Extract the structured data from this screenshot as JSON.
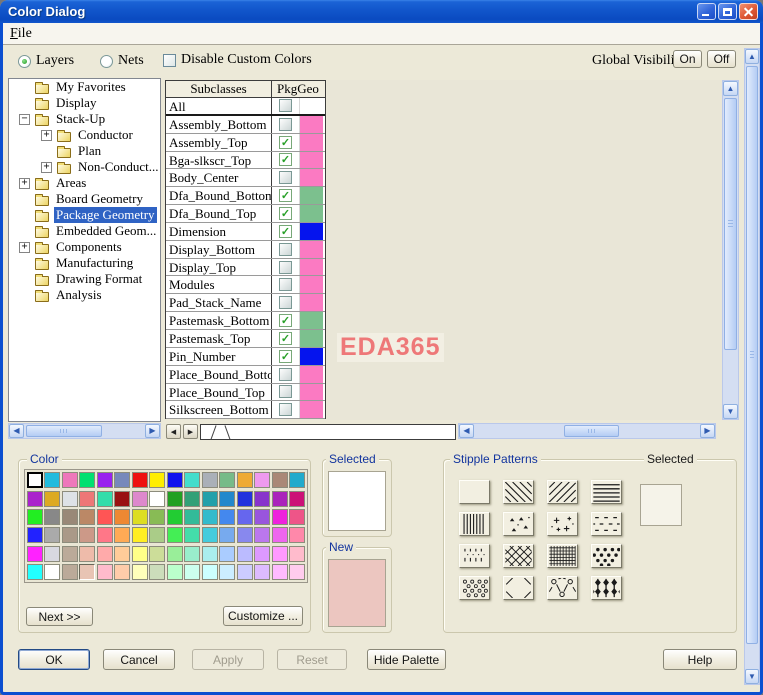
{
  "window": {
    "title": "Color Dialog"
  },
  "menu": {
    "items": [
      {
        "label": "File"
      }
    ]
  },
  "toolbar": {
    "layers_label": "Layers",
    "nets_label": "Nets",
    "disable_custom_label": "Disable Custom Colors",
    "global_visibility_label": "Global Visibility:",
    "on_label": "On",
    "off_label": "Off"
  },
  "tree": {
    "items": [
      {
        "label": "My Favorites",
        "level": 1,
        "expander": "none",
        "selected": false
      },
      {
        "label": "Display",
        "level": 1,
        "expander": "none",
        "selected": false
      },
      {
        "label": "Stack-Up",
        "level": 1,
        "expander": "minus",
        "selected": false
      },
      {
        "label": "Conductor",
        "level": 2,
        "expander": "plus",
        "selected": false
      },
      {
        "label": "Plan",
        "level": 2,
        "expander": "none",
        "selected": false
      },
      {
        "label": "Non-Conduct...",
        "level": 2,
        "expander": "plus",
        "selected": false
      },
      {
        "label": "Areas",
        "level": 1,
        "expander": "plus",
        "selected": false
      },
      {
        "label": "Board Geometry",
        "level": 1,
        "expander": "none",
        "selected": false
      },
      {
        "label": "Package Geometry",
        "level": 1,
        "expander": "none",
        "selected": true
      },
      {
        "label": "Embedded Geom...",
        "level": 1,
        "expander": "none",
        "selected": false
      },
      {
        "label": "Components",
        "level": 1,
        "expander": "plus",
        "selected": false
      },
      {
        "label": "Manufacturing",
        "level": 1,
        "expander": "none",
        "selected": false
      },
      {
        "label": "Drawing Format",
        "level": 1,
        "expander": "none",
        "selected": false
      },
      {
        "label": "Analysis",
        "level": 1,
        "expander": "none",
        "selected": false
      }
    ]
  },
  "table": {
    "columns": [
      "Subclasses",
      "PkgGeo"
    ],
    "rows": [
      {
        "name": "All",
        "checked": false,
        "color": null
      },
      {
        "name": "Assembly_Bottom",
        "checked": false,
        "color": "#fb7ac2"
      },
      {
        "name": "Assembly_Top",
        "checked": true,
        "color": "#fb7ac2"
      },
      {
        "name": "Bga-slkscr_Top",
        "checked": true,
        "color": "#fb7ac2"
      },
      {
        "name": "Body_Center",
        "checked": false,
        "color": "#fb7ac2"
      },
      {
        "name": "Dfa_Bound_Bottom",
        "checked": true,
        "color": "#7cc08e"
      },
      {
        "name": "Dfa_Bound_Top",
        "checked": true,
        "color": "#7cc08e"
      },
      {
        "name": "Dimension",
        "checked": true,
        "color": "#0514ee"
      },
      {
        "name": "Display_Bottom",
        "checked": false,
        "color": "#fb7ac2"
      },
      {
        "name": "Display_Top",
        "checked": false,
        "color": "#fb7ac2"
      },
      {
        "name": "Modules",
        "checked": false,
        "color": "#fb7ac2"
      },
      {
        "name": "Pad_Stack_Name",
        "checked": false,
        "color": "#fb7ac2"
      },
      {
        "name": "Pastemask_Bottom",
        "checked": true,
        "color": "#7cc08e"
      },
      {
        "name": "Pastemask_Top",
        "checked": true,
        "color": "#7cc08e"
      },
      {
        "name": "Pin_Number",
        "checked": true,
        "color": "#0514ee"
      },
      {
        "name": "Place_Bound_Bottom",
        "checked": false,
        "color": "#fb7ac2"
      },
      {
        "name": "Place_Bound_Top",
        "checked": false,
        "color": "#fb7ac2"
      },
      {
        "name": "Silkscreen_Bottom",
        "checked": false,
        "color": "#fb7ac2"
      }
    ]
  },
  "canvas": {
    "watermark": "EDA365",
    "watermark_color": "#ee7878"
  },
  "palette": {
    "title": "Color",
    "next_label": "Next >>",
    "customize_label": "Customize ...",
    "selected": {
      "row": 0,
      "col": 0
    },
    "pressed": {
      "row": 5,
      "col": 3
    },
    "rows": [
      [
        "#ffffff",
        "#22bbdd",
        "#ee77bb",
        "#00e070",
        "#9922ee",
        "#7788bb",
        "#ee1111",
        "#ffee00",
        "#1111ee",
        "#44ddcc",
        "#aab0b8",
        "#77bb88",
        "#eeaa33",
        "#ee99ee",
        "#aa8877",
        "#22aacc"
      ],
      [
        "#aa22cc",
        "#ddaa22",
        "#dde2e6",
        "#ee7777",
        "#33ddaa",
        "#991111",
        "#dd88cc",
        "#ffffff",
        "#22a022",
        "#33a077",
        "#22a0aa",
        "#2288cc",
        "#2233dd",
        "#8833cc",
        "#aa22bb",
        "#cc1177"
      ],
      [
        "#22ee22",
        "#888888",
        "#998877",
        "#bb8866",
        "#ff5555",
        "#ee8833",
        "#dddd22",
        "#88bb55",
        "#22cc33",
        "#33bb99",
        "#33bbcc",
        "#4488ee",
        "#6666ee",
        "#9955dd",
        "#ee22dd",
        "#ee5588"
      ],
      [
        "#2222ff",
        "#aaaaaa",
        "#aa9988",
        "#cc9988",
        "#ff7788",
        "#ffaa55",
        "#ffee22",
        "#aacc88",
        "#44ee55",
        "#44ddaa",
        "#44ccdd",
        "#77aaee",
        "#8888ee",
        "#bb77ee",
        "#ee66ee",
        "#ff88aa"
      ],
      [
        "#ff22ff",
        "#d8d8e0",
        "#bbaa99",
        "#eebbaa",
        "#ffaaaa",
        "#ffcc99",
        "#ffff88",
        "#ccdd99",
        "#99ee99",
        "#99eecc",
        "#aaeeee",
        "#aaccff",
        "#bbbbff",
        "#dd99ff",
        "#ff99ff",
        "#ffbbcc"
      ],
      [
        "#22ffff",
        "#ffffff",
        "#bbaa99",
        "#e8c4b4",
        "#ffbbcc",
        "#ffccaa",
        "#ffffbb",
        "#ccddbb",
        "#bbffcc",
        "#ccffee",
        "#ccffff",
        "#cceeff",
        "#ccccff",
        "#ddbbff",
        "#ffbbff",
        "#ffccee"
      ]
    ]
  },
  "selected_color": {
    "title": "Selected",
    "value": "#ffffff"
  },
  "new_color": {
    "title": "New",
    "value": "#ecc6c0"
  },
  "stipple": {
    "title": "Stipple Patterns",
    "selected_label": "Selected",
    "patterns": [
      "solid",
      "diagonal-down",
      "diagonal-up",
      "horizontal-lines",
      "vertical-lines",
      "triangles",
      "plus-signs",
      "dashes",
      "vertical-dashes",
      "diamond-lattice",
      "grid",
      "dots-filled",
      "circles-open",
      "corner-diagonals",
      "circle-x-lattice",
      "diamonds-filled"
    ]
  },
  "buttons": {
    "ok": "OK",
    "cancel": "Cancel",
    "apply": "Apply",
    "reset": "Reset",
    "hide_palette": "Hide Palette",
    "help": "Help"
  }
}
